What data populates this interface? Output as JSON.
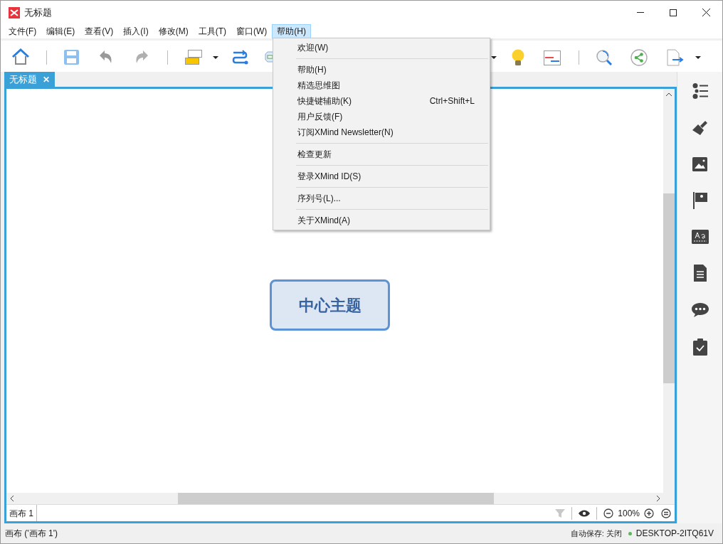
{
  "window": {
    "title": "无标题"
  },
  "menu_bar": [
    {
      "label": "文件(F)",
      "selected": false
    },
    {
      "label": "编辑(E)",
      "selected": false
    },
    {
      "label": "查看(V)",
      "selected": false
    },
    {
      "label": "插入(I)",
      "selected": false
    },
    {
      "label": "修改(M)",
      "selected": false
    },
    {
      "label": "工具(T)",
      "selected": false
    },
    {
      "label": "窗口(W)",
      "selected": false
    },
    {
      "label": "帮助(H)",
      "selected": true
    }
  ],
  "editor_tabs": [
    {
      "label": "无标题",
      "close": "✕",
      "selected": true
    }
  ],
  "canvas": {
    "central_topic": "中心主题"
  },
  "help_menu": [
    {
      "kind": "item",
      "label": "欢迎(W)"
    },
    {
      "kind": "separator"
    },
    {
      "kind": "item",
      "label": "帮助(H)"
    },
    {
      "kind": "item",
      "label": "精选思维图"
    },
    {
      "kind": "item",
      "label": "快捷键辅助(K)",
      "shortcut": "Ctrl+Shift+L"
    },
    {
      "kind": "item",
      "label": "用户反馈(F)"
    },
    {
      "kind": "item",
      "label": "订阅XMind Newsletter(N)"
    },
    {
      "kind": "separator"
    },
    {
      "kind": "item",
      "label": "检查更新"
    },
    {
      "kind": "separator"
    },
    {
      "kind": "item",
      "label": "登录XMind ID(S)"
    },
    {
      "kind": "separator"
    },
    {
      "kind": "item",
      "label": "序列号(L)..."
    },
    {
      "kind": "separator"
    },
    {
      "kind": "item",
      "label": "关于XMind(A)"
    }
  ],
  "sheet_tabs": [
    {
      "label": "画布 1",
      "selected": true
    }
  ],
  "zoom": "100%",
  "status_bar": {
    "left": "画布 ('画布 1')",
    "autosave": "自动保存: 关闭",
    "host": "DESKTOP-2ITQ61V"
  }
}
